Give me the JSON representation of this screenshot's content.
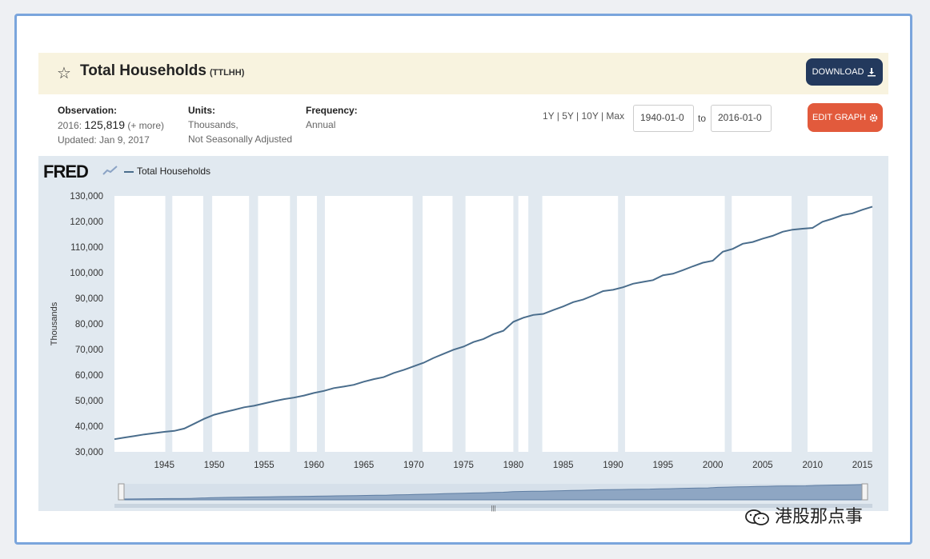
{
  "header": {
    "title": "Total Households",
    "series_id": "(TTLHH)",
    "download_label": "DOWNLOAD",
    "download_icon": "download-icon",
    "star_icon": "star-outline-icon"
  },
  "info": {
    "observation_label": "Observation:",
    "observation_year": "2016:",
    "observation_value": "125,819",
    "observation_more": "(+ more)",
    "updated": "Updated: Jan 9, 2017",
    "units_label": "Units:",
    "units_line1": "Thousands,",
    "units_line2": "Not Seasonally Adjusted",
    "frequency_label": "Frequency:",
    "frequency_value": "Annual"
  },
  "controls": {
    "range_links": "1Y | 5Y | 10Y | Max",
    "start_date": "1940-01-0",
    "to_label": "to",
    "end_date": "2016-01-0",
    "edit_label": "EDIT GRAPH",
    "edit_icon": "gear-icon"
  },
  "brand": {
    "logo": "FRED",
    "logo_icon": "fred-graph-icon"
  },
  "watermark": {
    "text": "港股那点事",
    "icon": "wechat-icon"
  },
  "colors": {
    "line": "#4a6d8c",
    "recession": "#e1e9f0",
    "plot_bg": "#ffffff",
    "download_btn": "#23395d",
    "edit_btn": "#e25a3c"
  },
  "chart_data": {
    "type": "line",
    "title": "",
    "xlabel": "",
    "ylabel": "Thousands",
    "xlim": [
      1940,
      2016
    ],
    "ylim": [
      30000,
      130000
    ],
    "y_ticks": [
      30000,
      40000,
      50000,
      60000,
      70000,
      80000,
      90000,
      100000,
      110000,
      120000,
      130000
    ],
    "y_tick_labels": [
      "30,000",
      "40,000",
      "50,000",
      "60,000",
      "70,000",
      "80,000",
      "90,000",
      "100,000",
      "110,000",
      "120,000",
      "130,000"
    ],
    "x_ticks": [
      1945,
      1950,
      1955,
      1960,
      1965,
      1970,
      1975,
      1980,
      1985,
      1990,
      1995,
      2000,
      2005,
      2010,
      2015
    ],
    "x_tick_labels": [
      "1945",
      "1950",
      "1955",
      "1960",
      "1965",
      "1970",
      "1975",
      "1980",
      "1985",
      "1990",
      "1995",
      "2000",
      "2005",
      "2010",
      "2015"
    ],
    "legend": "top-left",
    "grid": false,
    "recession_shading": [
      [
        1945.1,
        1945.8
      ],
      [
        1948.9,
        1949.8
      ],
      [
        1953.5,
        1954.4
      ],
      [
        1957.6,
        1958.3
      ],
      [
        1960.3,
        1961.1
      ],
      [
        1969.9,
        1970.9
      ],
      [
        1973.9,
        1975.2
      ],
      [
        1980.0,
        1980.5
      ],
      [
        1981.5,
        1982.9
      ],
      [
        1990.5,
        1991.2
      ],
      [
        2001.2,
        2001.9
      ],
      [
        2007.9,
        2009.5
      ]
    ],
    "series": [
      {
        "name": "Total Households",
        "x": [
          1940,
          1941,
          1942,
          1943,
          1944,
          1945,
          1946,
          1947,
          1948,
          1949,
          1950,
          1951,
          1952,
          1953,
          1954,
          1955,
          1956,
          1957,
          1958,
          1959,
          1960,
          1961,
          1962,
          1963,
          1964,
          1965,
          1966,
          1967,
          1968,
          1969,
          1970,
          1971,
          1972,
          1973,
          1974,
          1975,
          1976,
          1977,
          1978,
          1979,
          1980,
          1981,
          1982,
          1983,
          1984,
          1985,
          1986,
          1987,
          1988,
          1989,
          1990,
          1991,
          1992,
          1993,
          1994,
          1995,
          1996,
          1997,
          1998,
          1999,
          2000,
          2001,
          2002,
          2003,
          2004,
          2005,
          2006,
          2007,
          2008,
          2009,
          2010,
          2011,
          2012,
          2013,
          2014,
          2015,
          2016
        ],
        "values": [
          34949,
          35600,
          36200,
          36800,
          37300,
          37800,
          38200,
          39100,
          41000,
          42900,
          44500,
          45500,
          46400,
          47400,
          48000,
          48900,
          49800,
          50600,
          51200,
          52000,
          53000,
          53800,
          54900,
          55500,
          56200,
          57400,
          58400,
          59200,
          60800,
          62000,
          63400,
          64800,
          66700,
          68300,
          69900,
          71100,
          72900,
          74100,
          76000,
          77300,
          80800,
          82400,
          83500,
          83900,
          85400,
          86800,
          88500,
          89500,
          91100,
          92800,
          93300,
          94300,
          95700,
          96400,
          97100,
          98990,
          99600,
          101000,
          102500,
          103900,
          104700,
          108200,
          109300,
          111300,
          112000,
          113300,
          114400,
          116000,
          116800,
          117200,
          117500,
          119900,
          121100,
          122500,
          123200,
          124600,
          125819
        ]
      }
    ]
  }
}
